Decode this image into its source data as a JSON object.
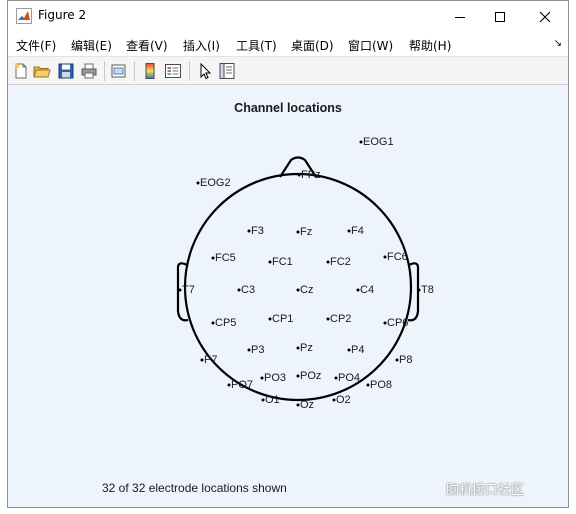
{
  "window": {
    "title": "Figure 2"
  },
  "menu": {
    "items": [
      {
        "label": "文件(F)",
        "name": "menu-file"
      },
      {
        "label": "编辑(E)",
        "name": "menu-edit"
      },
      {
        "label": "查看(V)",
        "name": "menu-view"
      },
      {
        "label": "插入(I)",
        "name": "menu-insert"
      },
      {
        "label": "工具(T)",
        "name": "menu-tools"
      },
      {
        "label": "桌面(D)",
        "name": "menu-desktop"
      },
      {
        "label": "窗口(W)",
        "name": "menu-window"
      },
      {
        "label": "帮助(H)",
        "name": "menu-help"
      }
    ]
  },
  "toolbar": {
    "buttons": [
      "new-figure-icon",
      "open-file-icon",
      "save-icon",
      "print-icon",
      "link-plot-icon",
      "insert-colorbar-icon",
      "insert-legend-icon",
      "edit-plot-arrow-icon",
      "property-inspector-icon"
    ]
  },
  "plot": {
    "title": "Channel locations",
    "footer": "32 of 32 electrode locations shown",
    "electrodes": [
      {
        "label": "EOG1"
      },
      {
        "label": "EOG2"
      },
      {
        "label": "FPz"
      },
      {
        "label": "F3"
      },
      {
        "label": "Fz"
      },
      {
        "label": "F4"
      },
      {
        "label": "FC5"
      },
      {
        "label": "FC1"
      },
      {
        "label": "FC2"
      },
      {
        "label": "FC6"
      },
      {
        "label": "T7"
      },
      {
        "label": "C3"
      },
      {
        "label": "Cz"
      },
      {
        "label": "C4"
      },
      {
        "label": "T8"
      },
      {
        "label": "CP5"
      },
      {
        "label": "CP1"
      },
      {
        "label": "CP2"
      },
      {
        "label": "CP6"
      },
      {
        "label": "P7"
      },
      {
        "label": "P3"
      },
      {
        "label": "Pz"
      },
      {
        "label": "P4"
      },
      {
        "label": "P8"
      },
      {
        "label": "PO7"
      },
      {
        "label": "PO3"
      },
      {
        "label": "POz"
      },
      {
        "label": "PO4"
      },
      {
        "label": "PO8"
      },
      {
        "label": "O1"
      },
      {
        "label": "Oz"
      },
      {
        "label": "O2"
      }
    ]
  },
  "watermark": "脑机接口社区"
}
